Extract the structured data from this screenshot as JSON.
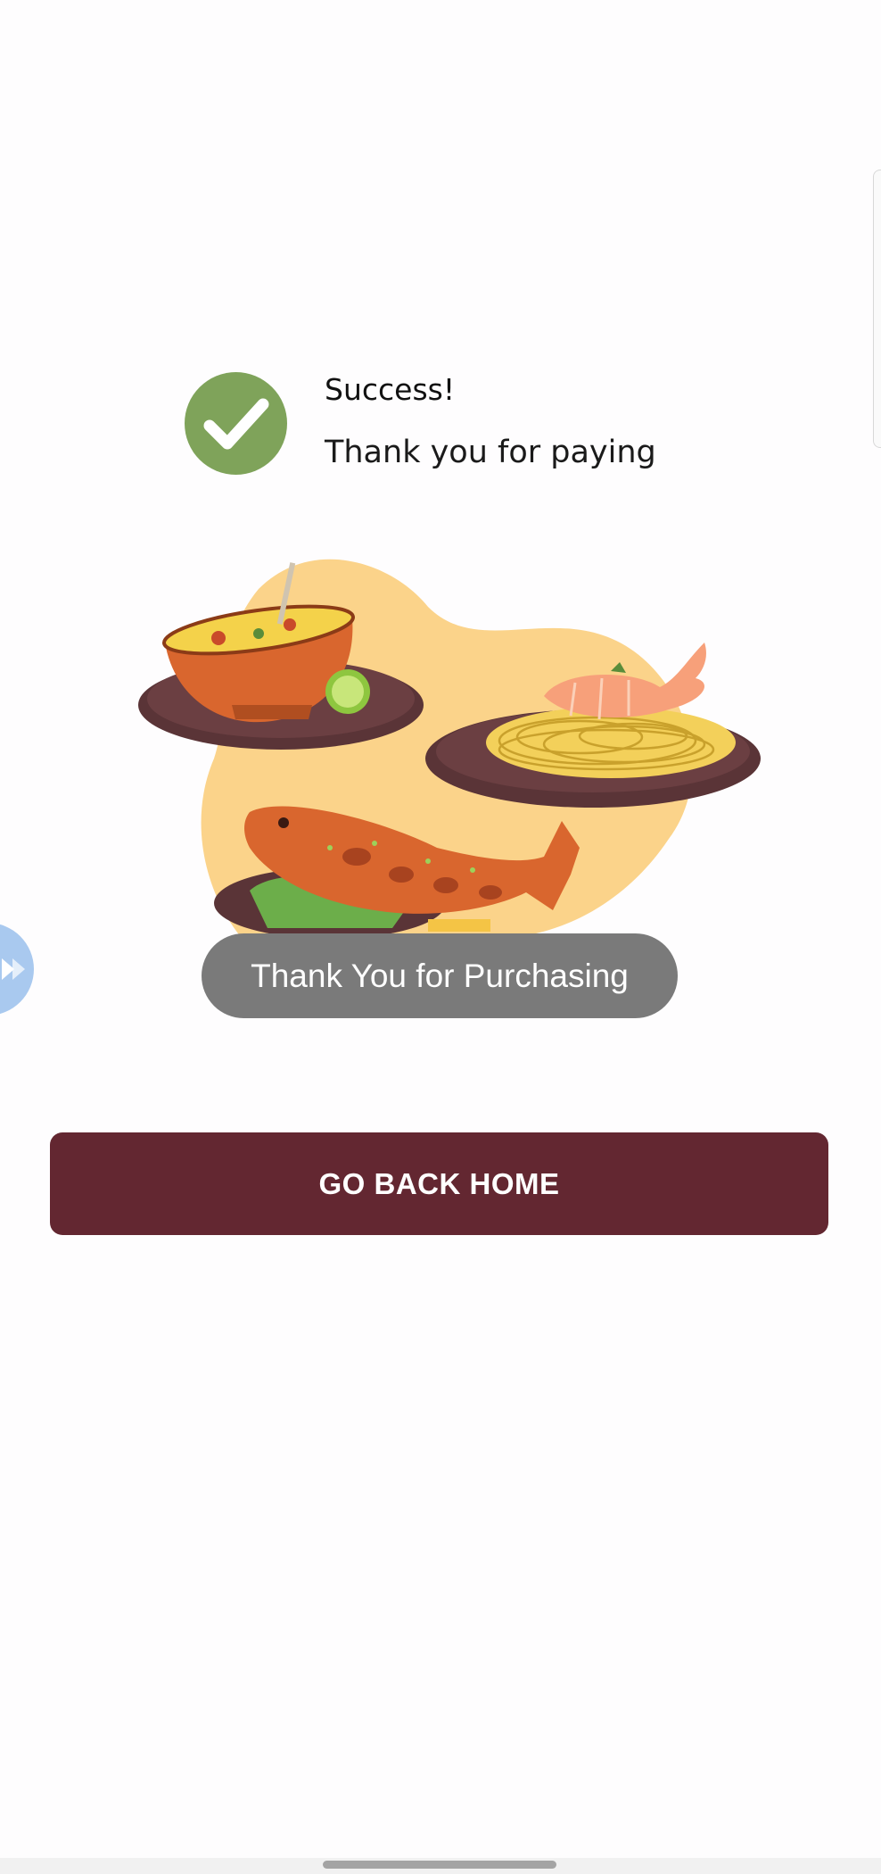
{
  "success": {
    "title": "Success!",
    "message": "Thank you for paying",
    "icon": "check-icon",
    "icon_color": "#7fa35a"
  },
  "illustration": {
    "subject": "food-plates-illustration"
  },
  "toast": {
    "text": "Thank You for Purchasing"
  },
  "actions": {
    "home_label": "GO BACK HOME",
    "button_color": "#632731"
  },
  "overlay": {
    "bubble_icon": "floating-bubble-icon",
    "bubble_color": "#a9c9ef"
  }
}
